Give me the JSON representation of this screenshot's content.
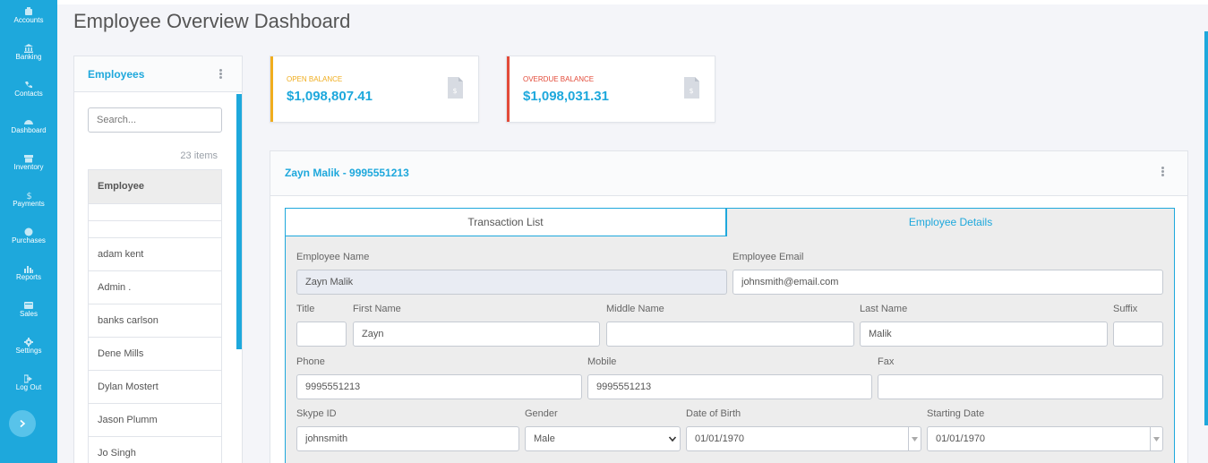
{
  "sidebar": {
    "items": [
      {
        "label": "Accounts",
        "icon": "accounts-icon"
      },
      {
        "label": "Banking",
        "icon": "bank-icon"
      },
      {
        "label": "Contacts",
        "icon": "phone-icon"
      },
      {
        "label": "Dashboard",
        "icon": "dashboard-icon"
      },
      {
        "label": "Inventory",
        "icon": "inventory-icon"
      },
      {
        "label": "Payments",
        "icon": "dollar-icon"
      },
      {
        "label": "Purchases",
        "icon": "purchases-icon"
      },
      {
        "label": "Reports",
        "icon": "chart-icon"
      },
      {
        "label": "Sales",
        "icon": "sales-icon"
      },
      {
        "label": "Settings",
        "icon": "gear-icon"
      },
      {
        "label": "Log Out",
        "icon": "logout-icon"
      }
    ],
    "toggle_icon": "chevron-right-icon"
  },
  "page": {
    "title": "Employee Overview Dashboard"
  },
  "employees": {
    "title": "Employees",
    "search_placeholder": "Search...",
    "count": "23 items",
    "column": "Employee",
    "rows": [
      "adam kent",
      "Admin .",
      "banks carlson",
      "Dene Mills",
      "Dylan Mostert",
      "Jason Plumm",
      "Jo Singh"
    ]
  },
  "balances": {
    "open": {
      "label": "OPEN BALANCE",
      "value": "$1,098,807.41",
      "color": "#f0ad1e"
    },
    "overdue": {
      "label": "OVERDUE BALANCE",
      "value": "$1,098,031.31",
      "color": "#e34b3a"
    }
  },
  "detail": {
    "title": "Zayn Malik - 9995551213",
    "tabs": {
      "transactions": "Transaction List",
      "details": "Employee Details"
    },
    "labels": {
      "name": "Employee Name",
      "email": "Employee Email",
      "title": "Title",
      "first": "First Name",
      "middle": "Middle Name",
      "last": "Last Name",
      "suffix": "Suffix",
      "phone": "Phone",
      "mobile": "Mobile",
      "fax": "Fax",
      "skype": "Skype ID",
      "gender": "Gender",
      "dob": "Date of Birth",
      "start": "Starting Date"
    },
    "values": {
      "name": "Zayn Malik",
      "email": "johnsmith@email.com",
      "title": "",
      "first": "Zayn",
      "middle": "",
      "last": "Malik",
      "suffix": "",
      "phone": "9995551213",
      "mobile": "9995551213",
      "fax": "",
      "skype": "johnsmith",
      "gender": "Male",
      "dob": "01/01/1970",
      "start": "01/01/1970"
    }
  },
  "colors": {
    "accent": "#1ea8dc"
  }
}
